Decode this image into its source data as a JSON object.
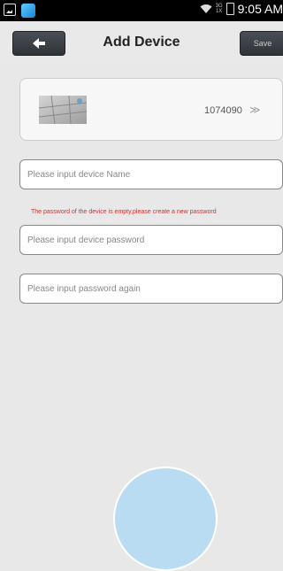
{
  "status_bar": {
    "time": "9:05 AM",
    "network_top": "3G",
    "network_bottom": "1X",
    "icons": [
      "gallery-icon",
      "app-icon",
      "wifi-icon",
      "signal-icon",
      "battery-icon"
    ]
  },
  "header": {
    "title": "Add Device",
    "save_label": "Save",
    "back_icon": "back-arrow-icon"
  },
  "device": {
    "id": "1074090",
    "chevron": "≫"
  },
  "form": {
    "name_placeholder": "Please input device Name",
    "warning": "The password of the device is empty,please create a new password",
    "password_placeholder": "Please input device password",
    "password_again_placeholder": "Please input password again"
  },
  "colors": {
    "warning": "#d0312d",
    "header_button": "#3a3e44",
    "background": "#e8e8e8"
  }
}
